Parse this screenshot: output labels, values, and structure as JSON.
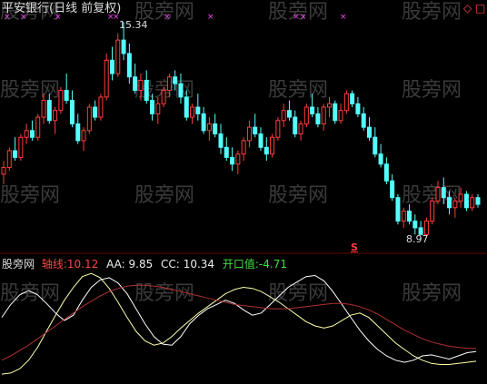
{
  "title": "平安银行(日线 前复权)",
  "top_right_icons": [
    "◇",
    "□"
  ],
  "watermark": "股旁网",
  "price_panel": {
    "high_label": "15.34",
    "low_label": "8.97",
    "buy_signal": "S"
  },
  "indicator_panel": {
    "name": "股旁网",
    "items": [
      {
        "label": "轴线:",
        "value": "10.12"
      },
      {
        "label": "AA:",
        "value": "9.85"
      },
      {
        "label": "CC:",
        "value": "10.34"
      },
      {
        "label": "开口值:",
        "value": "-4.71"
      }
    ]
  },
  "colors": {
    "up": "#ff3d3d",
    "down": "#54ffff",
    "marker": "#ff40ff",
    "axis_line": "#b03030",
    "aa_line": "#ffffff",
    "cc_line": "#ffffaa",
    "axis_label": "#ff4444",
    "open_label": "#44dd44"
  },
  "chart_data": {
    "type": "candlestick",
    "high": 15.34,
    "low": 8.97,
    "ohlc": [
      [
        10.8,
        11.2,
        10.5,
        11.0
      ],
      [
        11.0,
        11.6,
        10.9,
        11.5
      ],
      [
        11.5,
        11.9,
        11.2,
        11.3
      ],
      [
        11.3,
        12.0,
        11.2,
        11.9
      ],
      [
        11.9,
        12.3,
        11.7,
        12.1
      ],
      [
        12.1,
        12.4,
        11.8,
        11.9
      ],
      [
        11.9,
        12.6,
        11.8,
        12.5
      ],
      [
        12.5,
        13.2,
        12.3,
        13.0
      ],
      [
        13.0,
        13.2,
        12.3,
        12.4
      ],
      [
        12.4,
        12.8,
        12.0,
        12.7
      ],
      [
        12.7,
        13.4,
        12.6,
        13.3
      ],
      [
        13.3,
        13.8,
        12.9,
        13.0
      ],
      [
        13.0,
        13.3,
        12.2,
        12.3
      ],
      [
        12.3,
        12.6,
        11.7,
        11.8
      ],
      [
        11.8,
        12.2,
        11.5,
        12.1
      ],
      [
        12.1,
        12.9,
        12.0,
        12.8
      ],
      [
        12.8,
        13.0,
        12.4,
        12.5
      ],
      [
        12.5,
        13.2,
        12.4,
        13.1
      ],
      [
        13.1,
        14.4,
        13.0,
        14.2
      ],
      [
        14.2,
        14.6,
        13.6,
        13.8
      ],
      [
        13.8,
        15.0,
        13.7,
        14.8
      ],
      [
        14.8,
        15.34,
        14.2,
        14.4
      ],
      [
        14.4,
        14.7,
        13.5,
        13.7
      ],
      [
        13.7,
        14.1,
        13.2,
        13.3
      ],
      [
        13.3,
        13.8,
        13.0,
        13.6
      ],
      [
        13.6,
        13.9,
        12.9,
        13.0
      ],
      [
        13.0,
        13.2,
        12.4,
        12.6
      ],
      [
        12.6,
        13.1,
        12.3,
        12.9
      ],
      [
        12.9,
        13.4,
        12.8,
        13.3
      ],
      [
        13.3,
        13.8,
        13.1,
        13.7
      ],
      [
        13.7,
        13.9,
        13.3,
        13.5
      ],
      [
        13.5,
        13.8,
        12.9,
        13.1
      ],
      [
        13.1,
        13.3,
        12.4,
        12.5
      ],
      [
        12.5,
        12.9,
        12.3,
        12.8
      ],
      [
        12.8,
        13.2,
        12.4,
        12.6
      ],
      [
        12.6,
        12.8,
        12.0,
        12.1
      ],
      [
        12.1,
        12.5,
        11.8,
        12.3
      ],
      [
        12.3,
        12.6,
        11.9,
        12.0
      ],
      [
        12.0,
        12.3,
        11.4,
        11.6
      ],
      [
        11.6,
        11.9,
        11.2,
        11.3
      ],
      [
        11.3,
        11.6,
        10.9,
        11.1
      ],
      [
        11.1,
        11.5,
        10.8,
        11.4
      ],
      [
        11.4,
        11.9,
        11.2,
        11.8
      ],
      [
        11.8,
        12.4,
        11.6,
        12.2
      ],
      [
        12.2,
        12.6,
        11.9,
        12.0
      ],
      [
        12.0,
        12.2,
        11.5,
        11.6
      ],
      [
        11.6,
        11.9,
        11.2,
        11.4
      ],
      [
        11.4,
        12.0,
        11.3,
        11.9
      ],
      [
        11.9,
        12.5,
        11.8,
        12.4
      ],
      [
        12.4,
        12.9,
        12.2,
        12.7
      ],
      [
        12.7,
        13.0,
        12.4,
        12.5
      ],
      [
        12.5,
        12.7,
        11.9,
        12.0
      ],
      [
        12.0,
        12.4,
        11.8,
        12.3
      ],
      [
        12.3,
        12.9,
        12.2,
        12.8
      ],
      [
        12.8,
        13.2,
        12.5,
        12.6
      ],
      [
        12.6,
        12.8,
        12.2,
        12.3
      ],
      [
        12.3,
        12.9,
        12.1,
        12.8
      ],
      [
        12.8,
        13.1,
        12.5,
        12.9
      ],
      [
        12.9,
        13.0,
        12.3,
        12.4
      ],
      [
        12.4,
        12.9,
        12.3,
        12.7
      ],
      [
        12.7,
        13.3,
        12.6,
        13.2
      ],
      [
        13.2,
        13.3,
        12.8,
        12.9
      ],
      [
        12.9,
        13.1,
        12.5,
        12.6
      ],
      [
        12.6,
        12.8,
        12.1,
        12.2
      ],
      [
        12.2,
        12.5,
        11.8,
        11.9
      ],
      [
        11.9,
        12.2,
        11.3,
        11.4
      ],
      [
        11.4,
        11.7,
        11.0,
        11.1
      ],
      [
        11.1,
        11.3,
        10.5,
        10.6
      ],
      [
        10.6,
        10.8,
        10.0,
        10.1
      ],
      [
        10.1,
        10.2,
        9.3,
        9.4
      ],
      [
        9.4,
        9.8,
        9.2,
        9.7
      ],
      [
        9.7,
        9.9,
        9.3,
        9.4
      ],
      [
        9.4,
        9.6,
        9.0,
        9.2
      ],
      [
        9.2,
        9.4,
        8.97,
        9.0
      ],
      [
        9.0,
        9.5,
        8.98,
        9.4
      ],
      [
        9.4,
        10.1,
        9.3,
        10.0
      ],
      [
        10.0,
        10.6,
        9.9,
        10.4
      ],
      [
        10.4,
        10.7,
        9.9,
        10.1
      ],
      [
        10.1,
        10.3,
        9.6,
        9.8
      ],
      [
        9.8,
        10.1,
        9.5,
        10.0
      ],
      [
        10.0,
        10.4,
        9.8,
        10.2
      ],
      [
        10.2,
        10.3,
        9.7,
        9.8
      ],
      [
        9.8,
        10.2,
        9.7,
        10.1
      ],
      [
        10.1,
        10.2,
        9.8,
        9.9
      ]
    ],
    "indicator": {
      "axis_line": [
        0.18,
        0.22,
        0.27,
        0.32,
        0.38,
        0.44,
        0.5,
        0.56,
        0.62,
        0.68,
        0.73,
        0.78,
        0.82,
        0.85,
        0.87,
        0.88,
        0.88,
        0.87,
        0.86,
        0.84,
        0.82,
        0.8,
        0.78,
        0.76,
        0.74,
        0.72,
        0.7,
        0.69,
        0.68,
        0.67,
        0.66,
        0.66,
        0.66,
        0.67,
        0.68,
        0.69,
        0.7,
        0.71,
        0.71,
        0.7,
        0.68,
        0.65,
        0.61,
        0.56,
        0.51,
        0.46,
        0.42,
        0.38,
        0.35,
        0.33,
        0.31,
        0.3,
        0.29,
        0.29
      ],
      "aa_line": [
        0.58,
        0.7,
        0.79,
        0.83,
        0.79,
        0.71,
        0.62,
        0.55,
        0.6,
        0.74,
        0.86,
        0.93,
        0.95,
        0.9,
        0.8,
        0.66,
        0.52,
        0.4,
        0.33,
        0.32,
        0.4,
        0.52,
        0.6,
        0.66,
        0.7,
        0.74,
        0.71,
        0.65,
        0.6,
        0.62,
        0.7,
        0.78,
        0.86,
        0.91,
        0.96,
        0.97,
        0.92,
        0.82,
        0.7,
        0.58,
        0.46,
        0.36,
        0.28,
        0.22,
        0.18,
        0.16,
        0.18,
        0.22,
        0.23,
        0.21,
        0.19,
        0.22,
        0.25,
        0.26
      ],
      "cc_line": [
        0.05,
        0.06,
        0.1,
        0.18,
        0.3,
        0.45,
        0.6,
        0.74,
        0.86,
        0.96,
        0.99,
        0.95,
        0.85,
        0.72,
        0.58,
        0.45,
        0.36,
        0.32,
        0.34,
        0.4,
        0.48,
        0.55,
        0.62,
        0.68,
        0.74,
        0.8,
        0.84,
        0.86,
        0.85,
        0.82,
        0.77,
        0.72,
        0.66,
        0.6,
        0.54,
        0.5,
        0.48,
        0.5,
        0.55,
        0.6,
        0.62,
        0.58,
        0.5,
        0.42,
        0.34,
        0.28,
        0.22,
        0.18,
        0.15,
        0.14,
        0.14,
        0.15,
        0.16,
        0.17
      ]
    }
  }
}
